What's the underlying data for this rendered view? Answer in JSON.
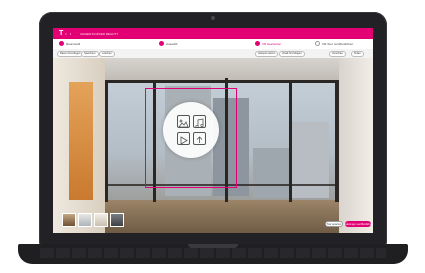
{
  "header": {
    "logo": "T",
    "dots": "• •",
    "title": "MAGENTA MIXED REALITY",
    "brand_color": "#e20074"
  },
  "steps": [
    {
      "label": "Raumwahl"
    },
    {
      "label": "Auswahl"
    },
    {
      "label": "VR bearbeiten"
    },
    {
      "label": "VR-Tour veröffentlichen"
    }
  ],
  "toolbar": {
    "left": [
      "Raum hinzufügen",
      "Speichern",
      "Löschen"
    ],
    "right": [
      "Hotspot setzen",
      "Inhalt hinzufügen",
      "Vorschau",
      "Teilen"
    ]
  },
  "hotspot": {
    "icons": [
      "image-icon",
      "music-icon",
      "play-icon",
      "upload-icon"
    ]
  },
  "footer": {
    "secondary_button": "Tour ansehen",
    "primary_button": "Änderungen veröffentlichen"
  }
}
